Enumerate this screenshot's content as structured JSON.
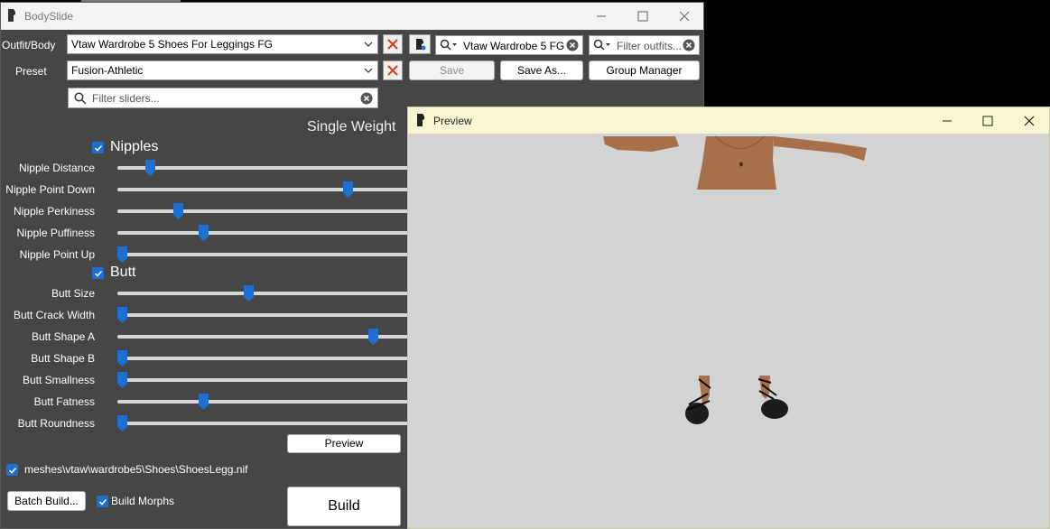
{
  "main_window": {
    "title": "BodySlide",
    "outfit_label": "Outfit/Body",
    "outfit_value": "Vtaw Wardrobe 5 Shoes For Leggings FG",
    "outfit_search_value": "Vtaw Wardrobe 5 FG",
    "outfit_filter_placeholder": "Filter outfits...",
    "preset_label": "Preset",
    "preset_value": "Fusion-Athletic",
    "save_label": "Save",
    "save_as_label": "Save As...",
    "group_manager_label": "Group Manager",
    "slider_filter_placeholder": "Filter sliders...",
    "weight_mode": "Single Weight",
    "preview_button": "Preview",
    "output_path": "meshes\\vtaw\\wardrobe5\\Shoes\\ShoesLegg.nif",
    "batch_build_label": "Batch Build...",
    "build_morphs_label": "Build Morphs",
    "build_label": "Build"
  },
  "slider_groups": [
    {
      "name": "Nipples",
      "checked": true,
      "sliders": [
        {
          "label": "Nipple Distance",
          "value": 10
        },
        {
          "label": "Nipple Point Down",
          "value": 80
        },
        {
          "label": "Nipple Perkiness",
          "value": 20
        },
        {
          "label": "Nipple Puffiness",
          "value": 29
        },
        {
          "label": "Nipple Point Up",
          "value": 0
        }
      ]
    },
    {
      "name": "Butt",
      "checked": true,
      "sliders": [
        {
          "label": "Butt Size",
          "value": 45
        },
        {
          "label": "Butt Crack Width",
          "value": 0
        },
        {
          "label": "Butt Shape A",
          "value": 89
        },
        {
          "label": "Butt Shape B",
          "value": 0
        },
        {
          "label": "Butt Smallness",
          "value": 0
        },
        {
          "label": "Butt Fatness",
          "value": 29
        },
        {
          "label": "Butt Roundness",
          "value": 0
        }
      ]
    }
  ],
  "preview_window": {
    "title": "Preview"
  },
  "colors": {
    "panel_bg": "#464646",
    "accent": "#1f6fd1",
    "preview_bg": "#d3d3d3",
    "preview_titlebar": "#f7f6d0",
    "clear_x": "#d9391f",
    "skin": "#a8704a"
  },
  "icons": [
    "app-icon",
    "minimize-icon",
    "maximize-icon",
    "close-icon",
    "clear-x-icon",
    "search-icon",
    "check-icon",
    "dropdown-arrow-icon"
  ]
}
